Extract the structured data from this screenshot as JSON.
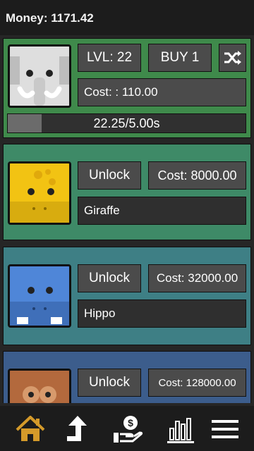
{
  "money_label": "Money: 1171.42",
  "cards": [
    {
      "animal": "Elephant",
      "color": "#3f8a4b",
      "level_label": "LVL: 22",
      "buy_label": "BUY 1",
      "shuffle_icon": "shuffle-icon",
      "cost_label": "Cost: : 110.00",
      "progress_fraction": 0.143,
      "progress_label": "22.25/5.00s"
    },
    {
      "animal": "Giraffe",
      "color": "#3e8a67",
      "unlock_label": "Unlock",
      "cost_label": "Cost: 8000.00",
      "name_label": "Giraffe"
    },
    {
      "animal": "Hippo",
      "color": "#3e7f85",
      "unlock_label": "Unlock",
      "cost_label": "Cost: 32000.00",
      "name_label": "Hippo"
    },
    {
      "animal": "Monkey",
      "color": "#3c5d8c",
      "unlock_label": "Unlock",
      "cost_label": "Cost: 128000.00"
    }
  ],
  "nav": [
    {
      "icon": "home-icon",
      "color": "#d49a2a"
    },
    {
      "icon": "upgrade-arrow-icon",
      "color": "#ffffff"
    },
    {
      "icon": "money-hand-icon",
      "color": "#ffffff"
    },
    {
      "icon": "stats-icon",
      "color": "#ffffff"
    },
    {
      "icon": "menu-icon",
      "color": "#ffffff"
    }
  ]
}
